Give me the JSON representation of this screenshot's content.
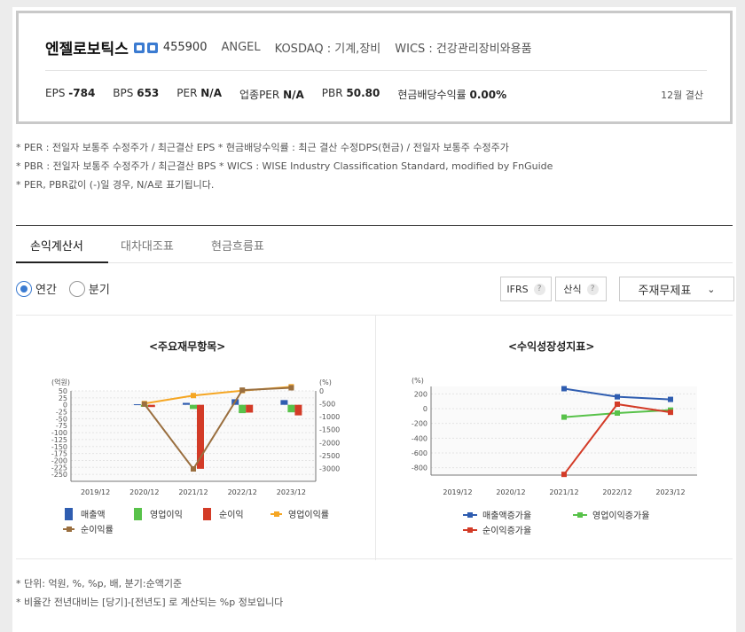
{
  "company": {
    "name": "엔젤로보틱스",
    "code": "455900",
    "eng": "ANGEL",
    "market": "KOSDAQ : 기계,장비",
    "wics": "WICS : 건강관리장비와용품"
  },
  "stats": [
    {
      "label": "EPS",
      "value": "-784"
    },
    {
      "label": "BPS",
      "value": "653"
    },
    {
      "label": "PER",
      "value": "N/A"
    },
    {
      "label": "업종PER",
      "value": "N/A"
    },
    {
      "label": "PBR",
      "value": "50.80"
    },
    {
      "label": "현금배당수익률",
      "value": "0.00%"
    }
  ],
  "settle": "12월 결산",
  "notes": [
    "* PER : 전일자 보통주 수정주가 / 최근결산 EPS * 현금배당수익률 : 최근 결산 수정DPS(현금) / 전일자 보통주 수정주가",
    "* PBR : 전일자 보통주 수정주가 / 최근결산 BPS * WICS : WISE Industry Classification Standard, modified by FnGuide",
    "* PER, PBR값이 (-)일 경우, N/A로 표기됩니다."
  ],
  "tabs": [
    "손익계산서",
    "대차대조표",
    "현금흐름표"
  ],
  "radios": {
    "annual": "연간",
    "quarter": "분기"
  },
  "controls": {
    "ifrs": "IFRS",
    "calc": "산식",
    "select": "주재무제표",
    "help": "?"
  },
  "footer_notes": [
    "* 단위: 억원, %, %p, 배, 분기:순액기준",
    "* 비율간 전년대비는 [당기]-[전년도] 로 계산되는 %p 정보입니다"
  ],
  "chart_data": [
    {
      "type": "bar",
      "title": "<주요재무항목>",
      "ylabel": "(억원)",
      "y2label": "(%)",
      "categories": [
        "2019/12",
        "2020/12",
        "2021/12",
        "2022/12",
        "2023/12"
      ],
      "ylim": [
        -275,
        50
      ],
      "yticks": [
        50,
        25,
        0,
        -25,
        -50,
        -75,
        -100,
        -125,
        -150,
        -175,
        -200,
        -225,
        -250
      ],
      "y2lim": [
        -3500,
        0
      ],
      "y2ticks": [
        0,
        -500,
        -1000,
        -1500,
        -2000,
        -2500,
        -3000
      ],
      "series": [
        {
          "name": "매출액",
          "kind": "bar",
          "color": "#2f5db0",
          "values": [
            null,
            2,
            7,
            20,
            17
          ]
        },
        {
          "name": "영업이익",
          "kind": "bar",
          "color": "#58c24a",
          "values": [
            null,
            -7,
            -15,
            -30,
            -27
          ]
        },
        {
          "name": "순이익",
          "kind": "bar",
          "color": "#d33b27",
          "values": [
            null,
            -8,
            -230,
            -28,
            -38
          ]
        },
        {
          "name": "영업이익률",
          "kind": "line",
          "axis": "right",
          "color": "#f5a623",
          "values": [
            null,
            -490,
            -180,
            10,
            160
          ]
        },
        {
          "name": "순이익률",
          "kind": "line",
          "axis": "right",
          "color": "#9a6f3f",
          "values": [
            null,
            -510,
            -3020,
            30,
            120
          ]
        }
      ]
    },
    {
      "type": "line",
      "title": "<수익성장성지표>",
      "ylabel": "(%)",
      "categories": [
        "2019/12",
        "2020/12",
        "2021/12",
        "2022/12",
        "2023/12"
      ],
      "ylim": [
        -900,
        300
      ],
      "yticks": [
        200,
        0,
        -200,
        -400,
        -600,
        -800
      ],
      "series": [
        {
          "name": "매출액증가율",
          "color": "#2f5db0",
          "values": [
            null,
            null,
            270,
            160,
            125
          ]
        },
        {
          "name": "영업이익증가율",
          "color": "#58c24a",
          "values": [
            null,
            null,
            -115,
            -60,
            -20
          ]
        },
        {
          "name": "순이익증가율",
          "color": "#d33b27",
          "values": [
            null,
            null,
            -890,
            60,
            -50
          ]
        }
      ]
    }
  ]
}
